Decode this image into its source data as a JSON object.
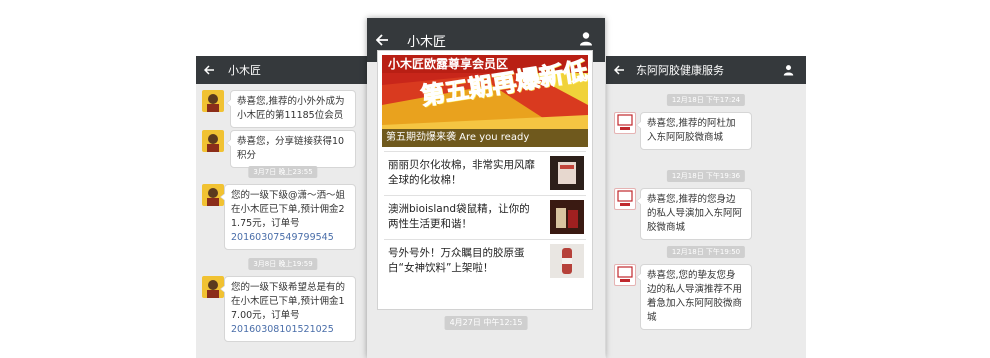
{
  "left": {
    "title": "小木匠",
    "messages": [
      {
        "text": "恭喜您,推荐的小外外成为小木匠的第11185位会员"
      },
      {
        "text": "恭喜您，分享链接获得10积分"
      },
      {
        "time": "3月7日 晚上23:55"
      },
      {
        "text": "您的一级下级@潇～洒～姐在小木匠已下单,预计佣金21.75元，订单号",
        "order": "20160307549799545"
      },
      {
        "time": "3月8日 晚上19:59"
      },
      {
        "text": "您的一级下级希望总是有的在小木匠已下单,预计佣金17.00元，订单号",
        "order": "20160308101521025"
      }
    ]
  },
  "middle": {
    "title": "小木匠",
    "banner": {
      "title": "小木匠欧露尊享会员区",
      "big": "第五期再爆新低",
      "caption": "第五期劲爆来袭    Are you ready"
    },
    "articles": [
      {
        "text": "丽丽贝尔化妆棉，非常实用风靡全球的化妆棉！"
      },
      {
        "text": "澳洲bioisland袋鼠精，让你的两性生活更和谐！"
      },
      {
        "text": "号外号外！万众瞩目的胶原蛋白“女神饮料”上架啦！"
      }
    ],
    "time": "4月27日 中午12:15"
  },
  "right": {
    "title": "东阿阿胶健康服务",
    "messages": [
      {
        "time": "12月18日 下午17:24"
      },
      {
        "text": "恭喜您,推荐的阿杜加入东阿阿胶微商城"
      },
      {
        "time": "12月18日 下午19:36"
      },
      {
        "text": "恭喜您,推荐的您身边的私人导演加入东阿阿胶微商城"
      },
      {
        "time": "12月18日 下午19:50"
      },
      {
        "text": "恭喜您,您的挚友您身边的私人导演推荐不用着急加入东阿阿胶微商城"
      }
    ]
  },
  "colors": {
    "nav_bar": "#35393c",
    "chat_bg": "#ebebeb",
    "order_link": "#4a6ea9",
    "banner_red": "#c8261a"
  }
}
